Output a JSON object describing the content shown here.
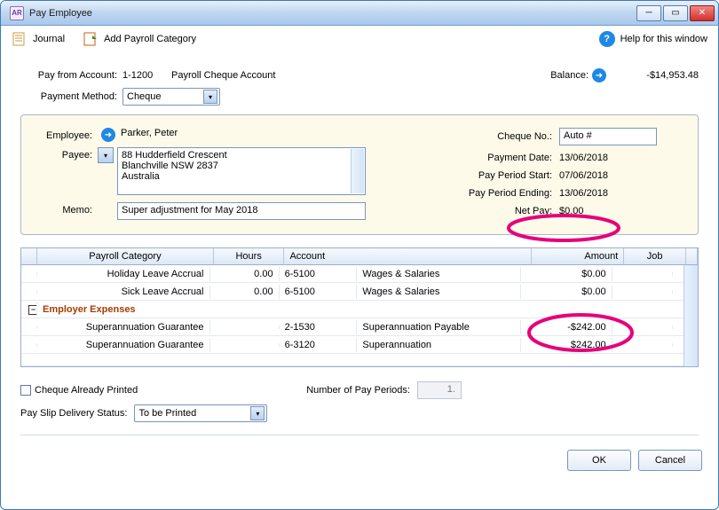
{
  "window": {
    "title": "Pay Employee",
    "app_icon": "AR"
  },
  "toolbar": {
    "journal": "Journal",
    "add_category": "Add Payroll Category",
    "help": "Help for this window"
  },
  "header": {
    "pay_from_label": "Pay from Account:",
    "account_code": "1-1200",
    "account_name": "Payroll Cheque Account",
    "balance_label": "Balance:",
    "balance_value": "-$14,953.48",
    "payment_method_label": "Payment Method:",
    "payment_method_value": "Cheque"
  },
  "employee_panel": {
    "employee_label": "Employee:",
    "employee_name": "Parker, Peter",
    "payee_label": "Payee:",
    "payee_address": "88 Hudderfield Crescent\nBlanchville  NSW   2837\nAustralia",
    "memo_label": "Memo:",
    "memo_value": "Super adjustment for May 2018",
    "cheque_no_label": "Cheque No.:",
    "cheque_no_value": "Auto #",
    "payment_date_label": "Payment Date:",
    "payment_date_value": "13/06/2018",
    "period_start_label": "Pay Period Start:",
    "period_start_value": "07/06/2018",
    "period_end_label": "Pay Period Ending:",
    "period_end_value": "13/06/2018",
    "net_pay_label": "Net Pay:",
    "net_pay_value": "$0.00"
  },
  "table": {
    "headers": {
      "category": "Payroll Category",
      "hours": "Hours",
      "account": "Account",
      "amount": "Amount",
      "job": "Job"
    },
    "rows": [
      {
        "type": "item",
        "category": "Holiday Leave Accrual",
        "hours": "0.00",
        "acct": "6-5100",
        "acctname": "Wages & Salaries",
        "amount": "$0.00",
        "job": ""
      },
      {
        "type": "item",
        "category": "Sick Leave Accrual",
        "hours": "0.00",
        "acct": "6-5100",
        "acctname": "Wages & Salaries",
        "amount": "$0.00",
        "job": ""
      },
      {
        "type": "group",
        "label": "Employer Expenses"
      },
      {
        "type": "item",
        "category": "Superannuation Guarantee",
        "hours": "",
        "acct": "2-1530",
        "acctname": "Superannuation Payable",
        "amount": "-$242.00",
        "job": ""
      },
      {
        "type": "item",
        "category": "Superannuation Guarantee",
        "hours": "",
        "acct": "6-3120",
        "acctname": "Superannuation",
        "amount": "$242.00",
        "job": ""
      }
    ]
  },
  "options": {
    "already_printed": "Cheque Already Printed",
    "num_periods_label": "Number of Pay Periods:",
    "num_periods_value": "1.",
    "delivery_label": "Pay Slip Delivery Status:",
    "delivery_value": "To be Printed"
  },
  "buttons": {
    "ok": "OK",
    "cancel": "Cancel"
  }
}
